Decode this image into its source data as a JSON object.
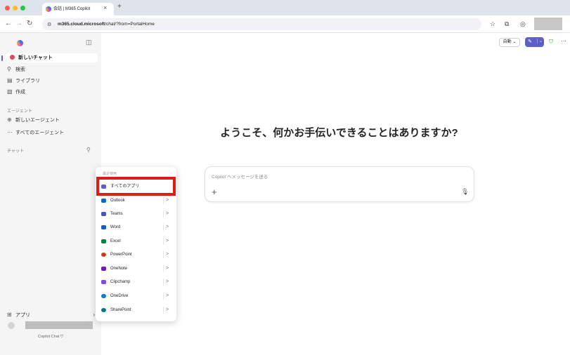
{
  "browser": {
    "tab_title": "会話 | M365 Copilot",
    "tab_close": "×",
    "new_tab": "+",
    "url_domain": "m365.cloud.microsoft",
    "url_path": "/chat/?from=PortalHome",
    "traffic_light_colors": [
      "#ff5f57",
      "#febc2e",
      "#28c840"
    ]
  },
  "sidebar": {
    "new_chat": "新しいチャット",
    "search": "検索",
    "library": "ライブラリ",
    "create": "作成",
    "agents_section": "エージェント",
    "new_agent": "新しいエージェント",
    "all_agents": "すべてのエージェント",
    "chat_section": "チャット",
    "apps": "アプリ",
    "footer": "Copilot Chat"
  },
  "header": {
    "mode_label": "自動"
  },
  "main": {
    "welcome": "ようこそ、何かお手伝いできることはありますか?",
    "composer_placeholder": "Copilot へメッセージを送る"
  },
  "popup": {
    "header": "最近使用",
    "items": [
      {
        "label": "すべてのアプリ",
        "color": "#5b5fc7"
      },
      {
        "label": "Outlook",
        "color": "#0f6cbd"
      },
      {
        "label": "Teams",
        "color": "#4b53bc"
      },
      {
        "label": "Word",
        "color": "#185abd"
      },
      {
        "label": "Excel",
        "color": "#107c41"
      },
      {
        "label": "PowerPoint",
        "color": "#c43e1c"
      },
      {
        "label": "OneNote",
        "color": "#7719aa"
      },
      {
        "label": "Clipchamp",
        "color": "#7b4cf3"
      },
      {
        "label": "OneDrive",
        "color": "#0f78d4"
      },
      {
        "label": "SharePoint",
        "color": "#03787c"
      }
    ]
  },
  "colors": {
    "accent": "#5b5fc7",
    "highlight": "#e11b14"
  }
}
